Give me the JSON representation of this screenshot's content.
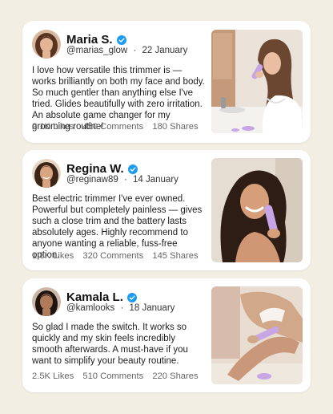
{
  "posts": [
    {
      "name": "Maria S.",
      "handle": "@marias_glow",
      "date": "22 January",
      "text": "I love how versatile this trimmer is — works brilliantly on both my face and body. So much gentler than anything else I've tried. Glides beautifully with zero irritation. An absolute game changer for my grooming routine!",
      "likes": "2.1K Likes",
      "comments": "450 Comments",
      "shares": "180 Shares"
    },
    {
      "name": "Regina W.",
      "handle": "@reginaw89",
      "date": "14 January",
      "text": "Best electric trimmer I've ever owned. Powerful but completely painless — gives such a close trim and the battery lasts absolutely ages. Highly recommend to anyone wanting a reliable, fuss-free option.",
      "likes": "1.8K Likes",
      "comments": "320 Comments",
      "shares": "145 Shares"
    },
    {
      "name": "Kamala L.",
      "handle": "@kamlooks",
      "date": "18 January",
      "text": "So glad I made the switch. It works so quickly and my skin feels incredibly smooth afterwards. A must-have if you want to simplify your beauty routine.",
      "likes": "2.5K Likes",
      "comments": "510 Comments",
      "shares": "220 Shares"
    }
  ],
  "separator": "·",
  "colors": {
    "background": "#f3eee3",
    "card": "#ffffff",
    "verified": "#1d9bf0",
    "product": "#c8a6e6"
  }
}
